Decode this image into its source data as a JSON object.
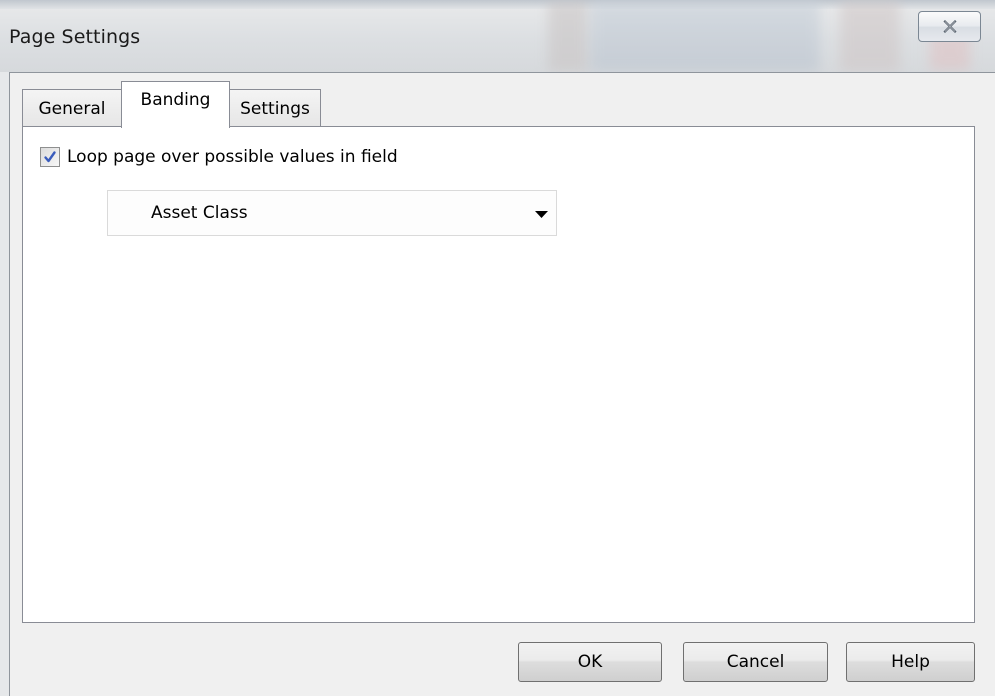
{
  "window": {
    "title": "Page Settings",
    "close_icon": "close-icon"
  },
  "tabs": [
    {
      "label": "General",
      "active": false
    },
    {
      "label": "Banding",
      "active": true
    },
    {
      "label": "Settings",
      "active": false
    }
  ],
  "banding": {
    "loop_checkbox": {
      "label": "Loop page over possible values in field",
      "checked": true
    },
    "field_select": {
      "value": "Asset Class"
    }
  },
  "buttons": {
    "ok": "OK",
    "cancel": "Cancel",
    "help": "Help"
  },
  "colors": {
    "check_mark": "#3a5cbc",
    "panel_background": "#ffffff",
    "dialog_background": "#f0f0f0"
  }
}
